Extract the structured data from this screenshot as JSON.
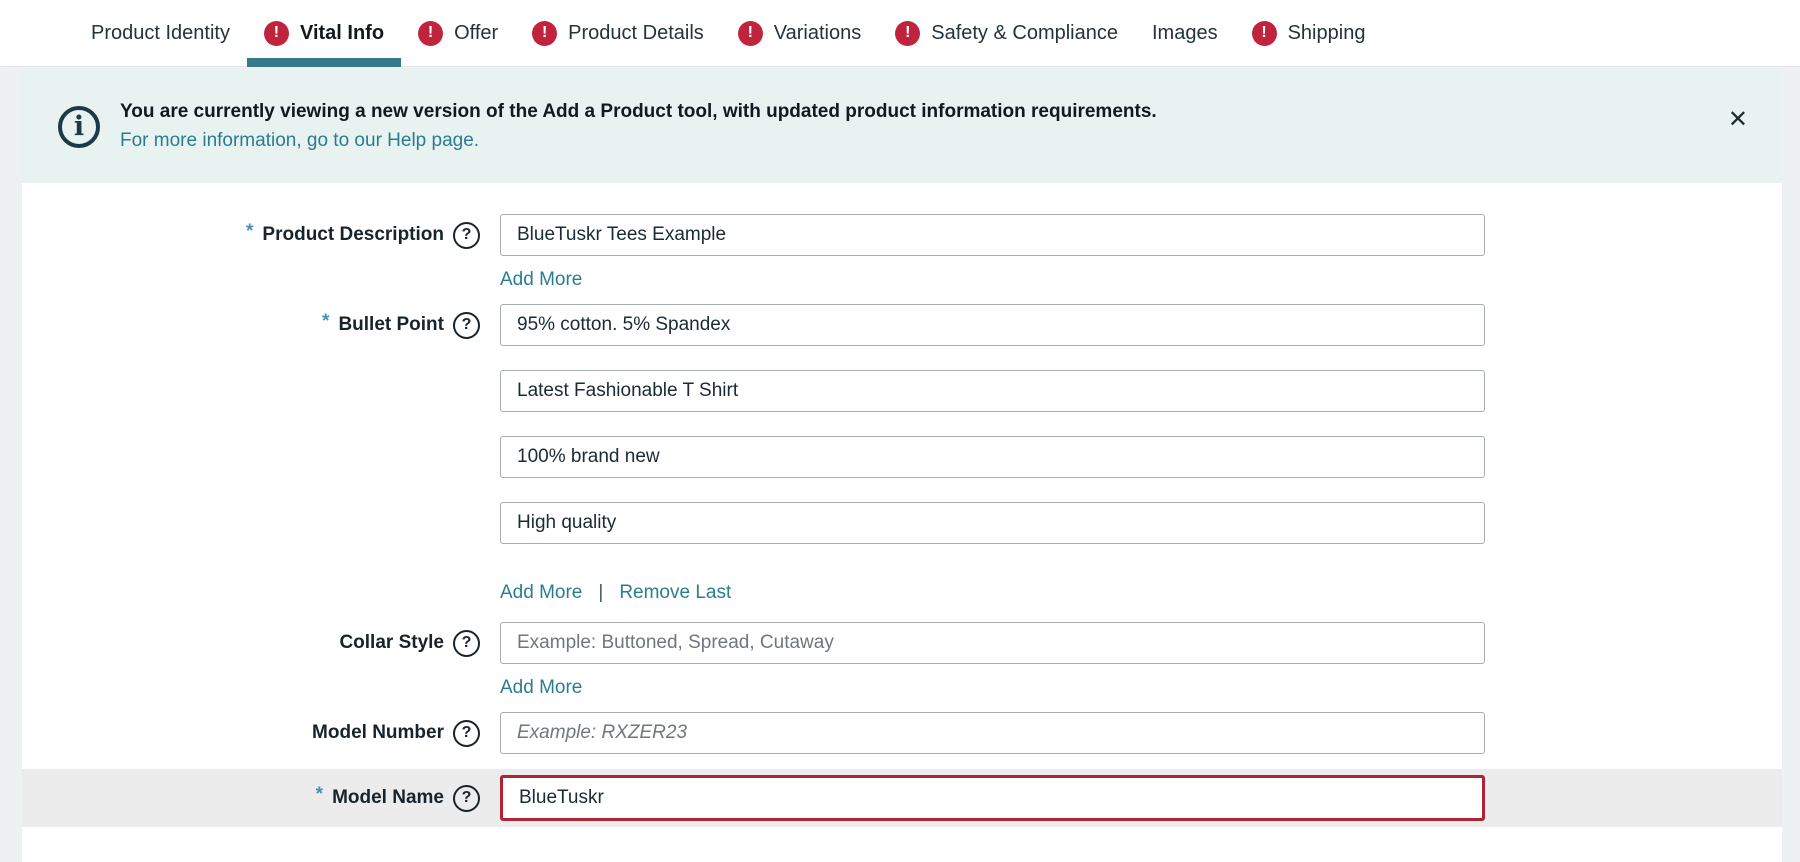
{
  "icons": {
    "required": "*",
    "help": "?",
    "info": "i",
    "close": "✕",
    "error": "!"
  },
  "tabs": [
    {
      "label": "Product Identity",
      "error": false,
      "active": false
    },
    {
      "label": "Vital Info",
      "error": true,
      "active": true
    },
    {
      "label": "Offer",
      "error": true,
      "active": false
    },
    {
      "label": "Product Details",
      "error": true,
      "active": false
    },
    {
      "label": "Variations",
      "error": true,
      "active": false
    },
    {
      "label": "Safety & Compliance",
      "error": true,
      "active": false
    },
    {
      "label": "Images",
      "error": false,
      "active": false
    },
    {
      "label": "Shipping",
      "error": true,
      "active": false
    }
  ],
  "banner": {
    "message": "You are currently viewing a new version of the Add a Product tool, with updated product information requirements.",
    "link": "For more information, go to our Help page."
  },
  "form": {
    "product_description": {
      "label": "Product Description",
      "required": true,
      "value": "BlueTuskr Tees Example",
      "add_more": "Add More"
    },
    "bullet_point": {
      "label": "Bullet Point",
      "required": true,
      "values": [
        "95% cotton. 5% Spandex",
        "Latest Fashionable T Shirt",
        "100% brand new",
        "High quality"
      ],
      "add_more": "Add More",
      "separator": "|",
      "remove_last": "Remove Last"
    },
    "collar_style": {
      "label": "Collar Style",
      "placeholder": "Example: Buttoned, Spread, Cutaway",
      "add_more": "Add More"
    },
    "model_number": {
      "label": "Model Number",
      "placeholder": "Example: RXZER23"
    },
    "model_name": {
      "label": "Model Name",
      "required": true,
      "value": "BlueTuskr"
    }
  },
  "colors": {
    "accent_teal": "#2a7d90",
    "underline_teal": "#35798c",
    "error_red": "#c0243c",
    "error_border": "#b12233",
    "banner_bg": "#e7f2f1",
    "page_bg": "#eef1f1",
    "highlight_bg": "#ececec",
    "label_color": "#17242c",
    "input_border": "#a8adb3",
    "placeholder_gray": "#6f777e",
    "link_teal": "#2a7d90",
    "text_dark": "#1a2b33",
    "icon_dark": "#1d3a47"
  }
}
